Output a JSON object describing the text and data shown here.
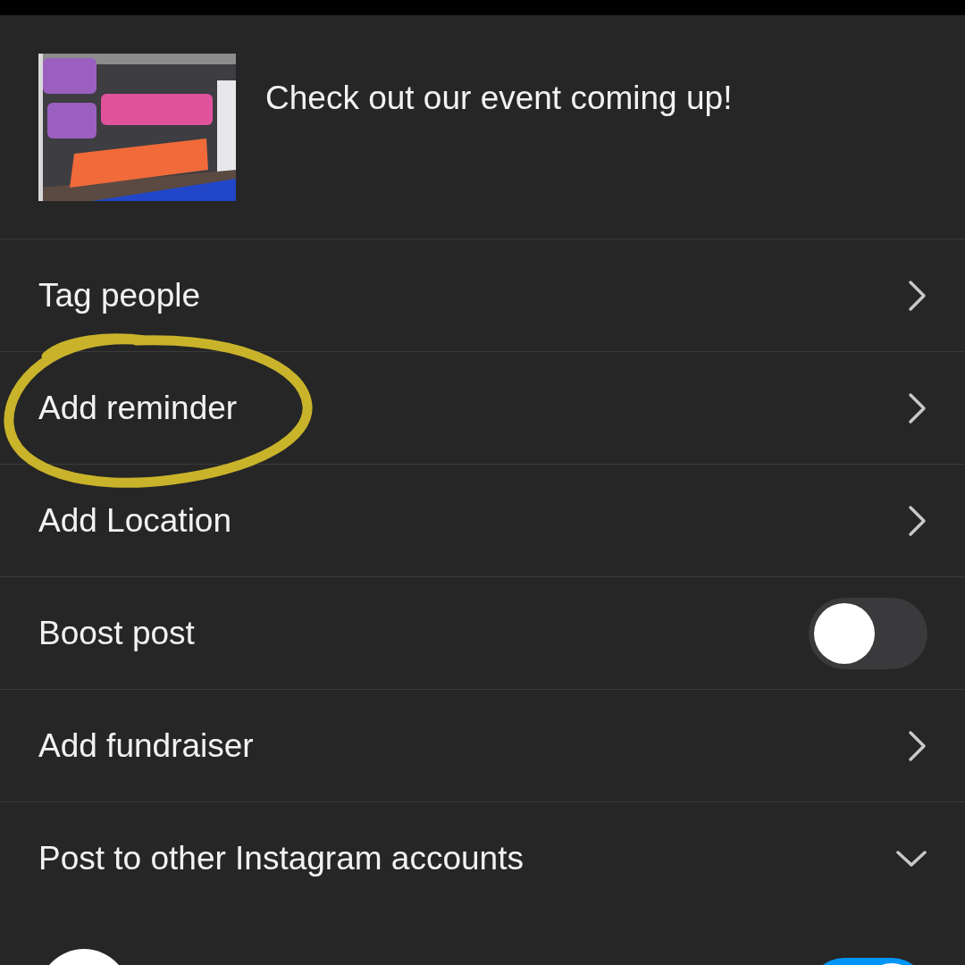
{
  "post": {
    "caption": "Check out our event coming up!"
  },
  "options": [
    {
      "kind": "link",
      "label": "Tag people",
      "circled": false
    },
    {
      "kind": "link",
      "label": "Add reminder",
      "circled": true
    },
    {
      "kind": "link",
      "label": "Add Location",
      "circled": false
    },
    {
      "kind": "toggle",
      "label": "Boost post",
      "on": false,
      "circled": false
    },
    {
      "kind": "link",
      "label": "Add fundraiser",
      "circled": false
    },
    {
      "kind": "expand",
      "label": "Post to other Instagram accounts",
      "expanded": true,
      "circled": false
    }
  ],
  "accounts": [
    {
      "on": true
    }
  ]
}
